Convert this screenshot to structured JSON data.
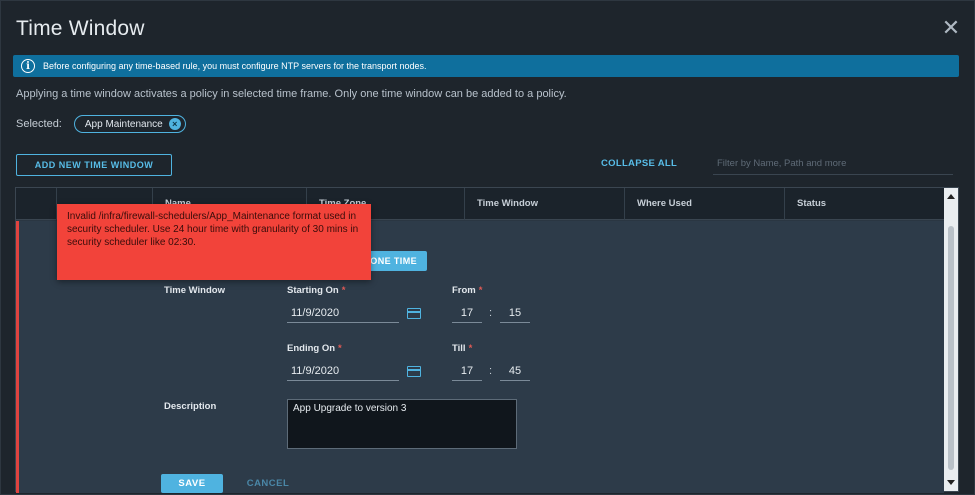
{
  "dialog": {
    "title": "Time Window",
    "close_icon": "close-icon"
  },
  "info_banner": {
    "icon": "info-icon",
    "text": "Before configuring any time-based rule, you must configure NTP servers for the transport nodes."
  },
  "description_text": "Applying a time window activates a policy in selected time frame. Only one time window can be added to a policy.",
  "selected": {
    "label": "Selected:",
    "chip_label": "App Maintenance",
    "chip_remove_icon": "close-circle-icon"
  },
  "toolbar": {
    "add_button_label": "ADD NEW TIME WINDOW",
    "collapse_all_label": "COLLAPSE ALL",
    "filter_placeholder": "Filter by Name, Path and more"
  },
  "table": {
    "columns": [
      "Name",
      "Time Zone",
      "Time Window",
      "Where Used",
      "Status"
    ]
  },
  "error_tooltip": {
    "text": "Invalid /infra/firewall-schedulers/App_Maintenance format used in security scheduler. Use 24 hour time with granularity of 30 mins in security scheduler like 02:30."
  },
  "form": {
    "one_time_button_label": "ONE TIME",
    "time_window_label": "Time Window",
    "starting_on_label": "Starting On",
    "starting_on_value": "11/9/2020",
    "from_label": "From",
    "from_hour": "17",
    "from_minute": "15",
    "ending_on_label": "Ending On",
    "ending_on_value": "11/9/2020",
    "till_label": "Till",
    "till_hour": "17",
    "till_minute": "45",
    "description_label": "Description",
    "description_value": "App Upgrade to version 3",
    "required_marker": "*",
    "time_separator": ":",
    "calendar_icon": "calendar-icon"
  },
  "actions": {
    "save_label": "SAVE",
    "cancel_label": "CANCEL"
  },
  "colors": {
    "accent": "#4fb3e0",
    "banner": "#0f6f9d",
    "error": "#f2433a",
    "dialog_bg": "#1e252c",
    "row_bg": "#2d3b49"
  }
}
